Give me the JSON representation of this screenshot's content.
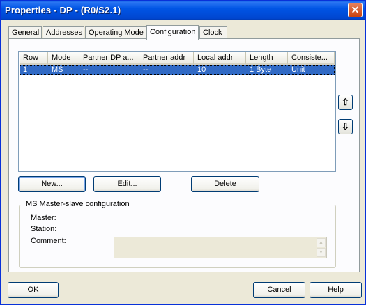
{
  "window": {
    "title": "Properties - DP - (R0/S2.1)",
    "close_glyph": "✕"
  },
  "tabs": [
    {
      "label": "General"
    },
    {
      "label": "Addresses"
    },
    {
      "label": "Operating Mode"
    },
    {
      "label": "Configuration"
    },
    {
      "label": "Clock"
    }
  ],
  "active_tab": "Configuration",
  "table": {
    "columns": [
      "Row",
      "Mode",
      "Partner DP a...",
      "Partner addr",
      "Local addr",
      "Length",
      "Consiste..."
    ],
    "rows": [
      [
        "1",
        "MS",
        "--",
        "--",
        "10",
        "1 Byte",
        "Unit"
      ]
    ]
  },
  "move_buttons": {
    "up_glyph": "⇧",
    "down_glyph": "⇩"
  },
  "actions": {
    "new": "New...",
    "edit": "Edit...",
    "delete": "Delete"
  },
  "group": {
    "title": "MS Master-slave configuration",
    "master_label": "Master:",
    "station_label": "Station:",
    "comment_label": "Comment:",
    "comment_value": ""
  },
  "footer": {
    "ok": "OK",
    "cancel": "Cancel",
    "help": "Help"
  }
}
